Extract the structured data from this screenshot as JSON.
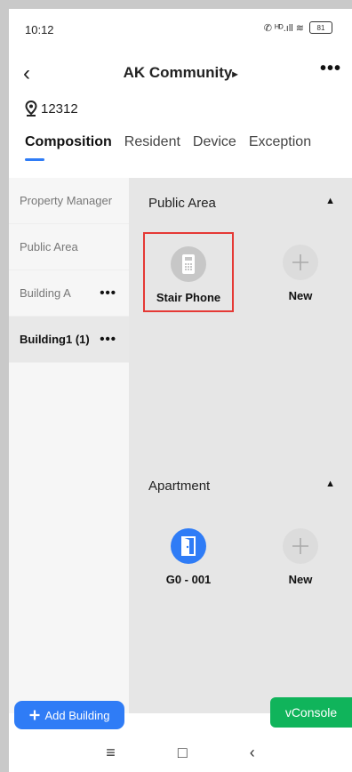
{
  "status_bar": {
    "time": "10:12",
    "indicators": "✆ ᴴᴰ.ıll ≋",
    "battery": "81"
  },
  "header": {
    "title": "AK Community",
    "title_arrow": "▸",
    "back": "‹",
    "more": "•••"
  },
  "location": {
    "code": "12312"
  },
  "tabs": [
    {
      "label": "Composition",
      "active": true
    },
    {
      "label": "Resident",
      "active": false
    },
    {
      "label": "Device",
      "active": false
    },
    {
      "label": "Exception",
      "active": false
    }
  ],
  "sidebar": {
    "items": [
      {
        "label": "Property Manager",
        "menu": ""
      },
      {
        "label": "Public Area",
        "menu": ""
      },
      {
        "label": "Building A",
        "menu": "•••"
      },
      {
        "label": "Building1 (1)",
        "menu": "•••",
        "selected": true
      }
    ]
  },
  "sections": {
    "public_area": {
      "title": "Public Area",
      "caret": "▲",
      "tiles": [
        {
          "label": "Stair Phone",
          "icon": "stair-phone-icon"
        },
        {
          "label": "New",
          "icon": "plus-icon"
        }
      ]
    },
    "apartment": {
      "title": "Apartment",
      "caret": "▲",
      "tiles": [
        {
          "label": "G0 - 001",
          "icon": "door-icon"
        },
        {
          "label": "New",
          "icon": "plus-icon"
        }
      ]
    }
  },
  "add_building_label": "Add Building",
  "vconsole_label": "vConsole",
  "nav": {
    "menu": "≡",
    "home": "□",
    "back": "‹"
  },
  "colors": {
    "accent": "#2f7cf6",
    "console": "#10b45b",
    "highlight": "#e53935"
  }
}
